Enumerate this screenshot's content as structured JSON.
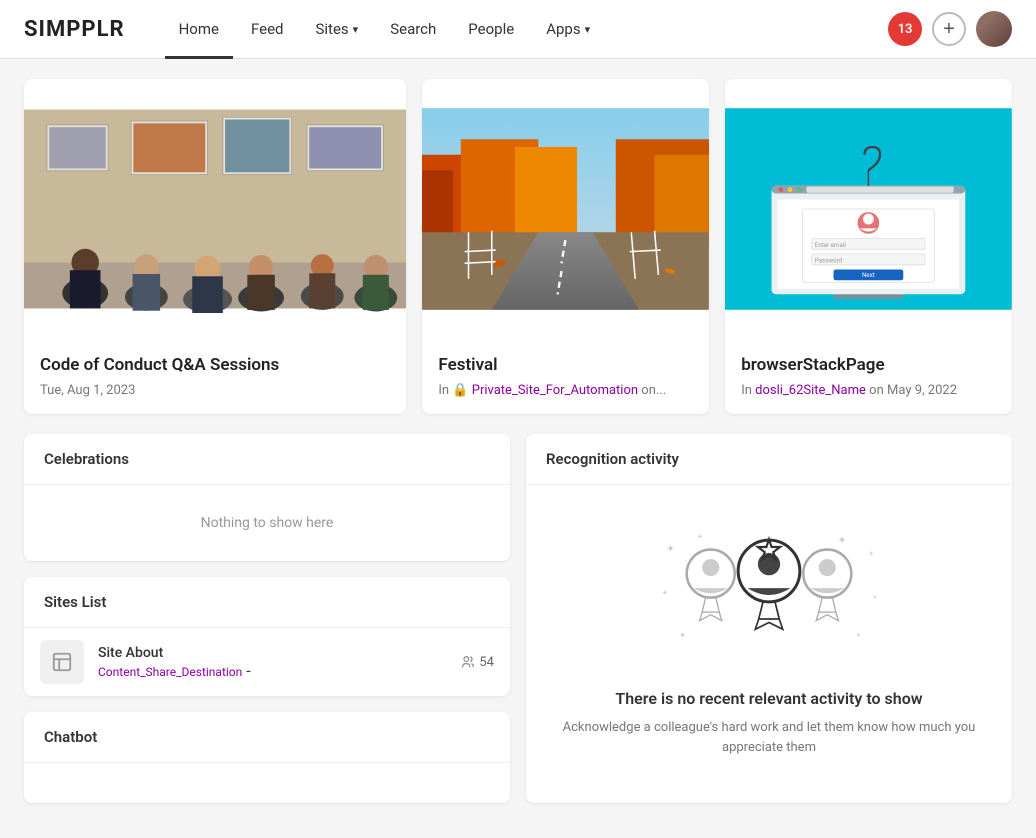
{
  "logo": "SIMPPLR",
  "nav": {
    "links": [
      {
        "label": "Home",
        "active": true,
        "has_dropdown": false
      },
      {
        "label": "Feed",
        "active": false,
        "has_dropdown": false
      },
      {
        "label": "Sites",
        "active": false,
        "has_dropdown": true
      },
      {
        "label": "Search",
        "active": false,
        "has_dropdown": false
      },
      {
        "label": "People",
        "active": false,
        "has_dropdown": false
      },
      {
        "label": "Apps",
        "active": false,
        "has_dropdown": true
      }
    ],
    "notification_count": "13",
    "add_button_label": "+",
    "avatar_alt": "User avatar"
  },
  "cards": [
    {
      "id": "card-1",
      "title": "Code of Conduct Q&A Sessions",
      "meta": "Tue, Aug 1, 2023",
      "meta_type": "date",
      "img_type": "art-gallery"
    },
    {
      "id": "card-2",
      "title": "Festival",
      "meta_prefix": "In",
      "meta_link": "Private_Site_For_Automation",
      "meta_suffix": "on...",
      "img_type": "autumn"
    },
    {
      "id": "card-3",
      "title": "browserStackPage",
      "meta_prefix": "In",
      "meta_link": "dosli_62Site_Name",
      "meta_suffix": "on May 9, 2022",
      "img_type": "browser"
    }
  ],
  "celebrations": {
    "header": "Celebrations",
    "empty_text": "Nothing to show here"
  },
  "sites_list": {
    "header": "Sites List",
    "items": [
      {
        "name": "Site About",
        "link_text": "Content_Share_Destination",
        "link_separator": " - ",
        "members": "54"
      }
    ]
  },
  "chatbot": {
    "header": "Chatbot"
  },
  "recognition": {
    "header": "Recognition activity",
    "empty_title": "There is no recent relevant activity to show",
    "empty_desc": "Acknowledge a colleague's hard work and let them know how much you appreciate them"
  }
}
